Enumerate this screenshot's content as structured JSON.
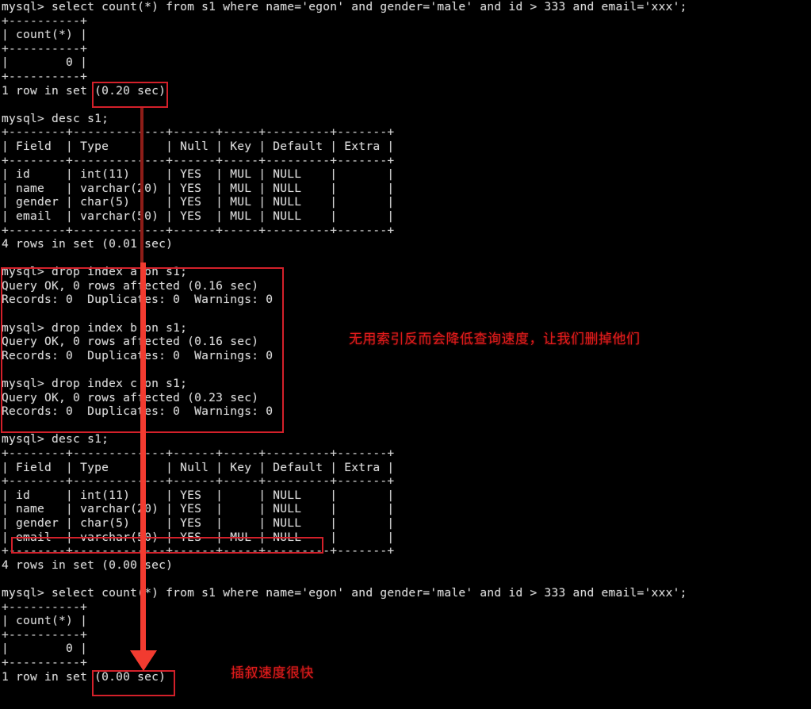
{
  "terminal": {
    "prompt": "mysql>",
    "lines": [
      "mysql> select count(*) from s1 where name='egon' and gender='male' and id > 333 and email='xxx';",
      "+----------+",
      "| count(*) |",
      "+----------+",
      "|        0 |",
      "+----------+",
      "1 row in set (0.20 sec)",
      "",
      "mysql> desc s1;",
      "+--------+-------------+------+-----+---------+-------+",
      "| Field  | Type        | Null | Key | Default | Extra |",
      "+--------+-------------+------+-----+---------+-------+",
      "| id     | int(11)     | YES  | MUL | NULL    |       |",
      "| name   | varchar(20) | YES  | MUL | NULL    |       |",
      "| gender | char(5)     | YES  | MUL | NULL    |       |",
      "| email  | varchar(50) | YES  | MUL | NULL    |       |",
      "+--------+-------------+------+-----+---------+-------+",
      "4 rows in set (0.01 sec)",
      "",
      "mysql> drop index a on s1;",
      "Query OK, 0 rows affected (0.16 sec)",
      "Records: 0  Duplicates: 0  Warnings: 0",
      "",
      "mysql> drop index b on s1;",
      "Query OK, 0 rows affected (0.16 sec)",
      "Records: 0  Duplicates: 0  Warnings: 0",
      "",
      "mysql> drop index c on s1;",
      "Query OK, 0 rows affected (0.23 sec)",
      "Records: 0  Duplicates: 0  Warnings: 0",
      "",
      "mysql> desc s1;",
      "+--------+-------------+------+-----+---------+-------+",
      "| Field  | Type        | Null | Key | Default | Extra |",
      "+--------+-------------+------+-----+---------+-------+",
      "| id     | int(11)     | YES  |     | NULL    |       |",
      "| name   | varchar(20) | YES  |     | NULL    |       |",
      "| gender | char(5)     | YES  |     | NULL    |       |",
      "| email  | varchar(50) | YES  | MUL | NULL    |       |",
      "+--------+-------------+------+-----+---------+-------+",
      "4 rows in set (0.00 sec)",
      "",
      "mysql> select count(*) from s1 where name='egon' and gender='male' and id > 333 and email='xxx';",
      "+----------+",
      "| count(*) |",
      "+----------+",
      "|        0 |",
      "+----------+",
      "1 row in set (0.00 sec)"
    ]
  },
  "queries": {
    "select_count": "select count(*) from s1 where name='egon' and gender='male' and id > 333 and email='xxx';",
    "desc_table": "desc s1;",
    "drop_index_a": "drop index a on s1;",
    "drop_index_b": "drop index b on s1;",
    "drop_index_c": "drop index c on s1;"
  },
  "results": {
    "first_count_value": "0",
    "first_elapsed": "(0.20 sec)",
    "first_rowcount": "1 row in set",
    "second_count_value": "0",
    "second_elapsed": "(0.00 sec)",
    "second_rowcount": "1 row in set",
    "desc_rowcount_before": "4 rows in set (0.01 sec)",
    "desc_rowcount_after": "4 rows in set (0.00 sec)",
    "drop_a_status": "Query OK, 0 rows affected (0.16 sec)",
    "drop_b_status": "Query OK, 0 rows affected (0.16 sec)",
    "drop_c_status": "Query OK, 0 rows affected (0.23 sec)",
    "records_line": "Records: 0  Duplicates: 0  Warnings: 0"
  },
  "schema": {
    "columns": [
      "Field",
      "Type",
      "Null",
      "Key",
      "Default",
      "Extra"
    ],
    "rows_before": [
      [
        "id",
        "int(11)",
        "YES",
        "MUL",
        "NULL",
        ""
      ],
      [
        "name",
        "varchar(20)",
        "YES",
        "MUL",
        "NULL",
        ""
      ],
      [
        "gender",
        "char(5)",
        "YES",
        "MUL",
        "NULL",
        ""
      ],
      [
        "email",
        "varchar(50)",
        "YES",
        "MUL",
        "NULL",
        ""
      ]
    ],
    "rows_after": [
      [
        "id",
        "int(11)",
        "YES",
        "",
        "NULL",
        ""
      ],
      [
        "name",
        "varchar(20)",
        "YES",
        "",
        "NULL",
        ""
      ],
      [
        "gender",
        "char(5)",
        "YES",
        "",
        "NULL",
        ""
      ],
      [
        "email",
        "varchar(50)",
        "YES",
        "MUL",
        "NULL",
        ""
      ]
    ]
  },
  "annotations": {
    "note_drop_indexes": "无用索引反而会降低查询速度，让我们删掉他们",
    "note_fast_query": "插叙速度很快"
  },
  "colors": {
    "annotation_red": "#e01b1b",
    "box_red": "#d3202a",
    "arrow_red": "#f23b30",
    "terminal_bg": "#000000",
    "terminal_fg": "#d8d8d8"
  }
}
